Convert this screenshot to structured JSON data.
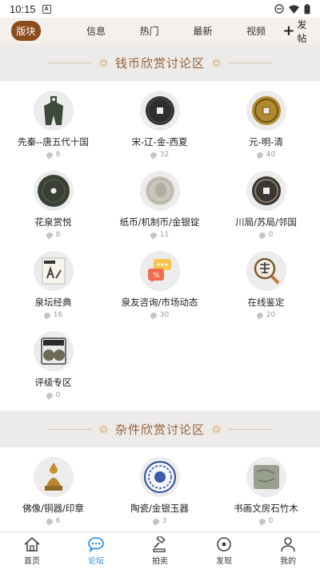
{
  "status": {
    "time": "10:15",
    "notify_badge": "A"
  },
  "topnav": {
    "tabs": [
      {
        "label": "版块",
        "active": true
      },
      {
        "label": "信息"
      },
      {
        "label": "热门"
      },
      {
        "label": "最新"
      },
      {
        "label": "视频"
      }
    ],
    "post_label": "发帖"
  },
  "sections": [
    {
      "title": "钱币欣赏讨论区",
      "items": [
        {
          "name": "先秦--唐五代十国",
          "count": "8",
          "icon": "spade-coin-icon"
        },
        {
          "name": "宋-辽-金-西夏",
          "count": "32",
          "icon": "square-hole-coin-icon"
        },
        {
          "name": "元-明-清",
          "count": "40",
          "icon": "brass-coin-icon"
        },
        {
          "name": "花泉赏悦",
          "count": "8",
          "icon": "green-coin-icon"
        },
        {
          "name": "纸币/机制币/金银锭",
          "count": "11",
          "icon": "silver-dollar-icon"
        },
        {
          "name": "川局/苏局/邻国",
          "count": "0",
          "icon": "dark-coin-icon"
        },
        {
          "name": "泉坛经典",
          "count": "16",
          "icon": "book-icon"
        },
        {
          "name": "泉友咨询/市场动态",
          "count": "30",
          "icon": "chat-bubbles-icon"
        },
        {
          "name": "在线鉴定",
          "count": "20",
          "icon": "magnifier-appraise-icon"
        },
        {
          "name": "评级专区",
          "count": "0",
          "icon": "graded-coin-slab-icon"
        }
      ]
    },
    {
      "title": "杂件欣赏讨论区",
      "items": [
        {
          "name": "佛像/铜器/印章",
          "count": "6",
          "icon": "buddha-statue-icon"
        },
        {
          "name": "陶瓷/金银玉器",
          "count": "3",
          "icon": "porcelain-plate-icon"
        },
        {
          "name": "书画文房石竹木",
          "count": "0",
          "icon": "stone-icon"
        }
      ]
    }
  ],
  "tabbar": [
    {
      "label": "首页",
      "icon": "home-icon"
    },
    {
      "label": "论坛",
      "icon": "forum-icon",
      "active": true
    },
    {
      "label": "拍卖",
      "icon": "gavel-icon"
    },
    {
      "label": "发现",
      "icon": "discover-icon"
    },
    {
      "label": "我的",
      "icon": "profile-icon"
    }
  ],
  "colors": {
    "accent": "#8a4b1f",
    "tab_active": "#1e88e5",
    "section_title": "#9a6235"
  }
}
